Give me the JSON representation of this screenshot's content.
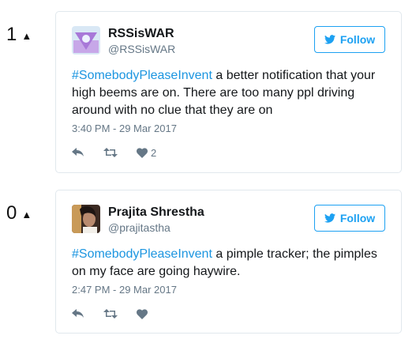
{
  "tweets": [
    {
      "vote_count": "1",
      "name": "RSSisWAR",
      "handle": "@RSSisWAR",
      "follow_label": "Follow",
      "hashtag": "#SomebodyPleaseInvent",
      "body": " a better notification that your high beems are on. There are too many ppl driving around with no clue that they are on",
      "timestamp": "3:40 PM - 29 Mar 2017",
      "like_count": "2"
    },
    {
      "vote_count": "0",
      "name": "Prajita Shrestha",
      "handle": "@prajitastha",
      "follow_label": "Follow",
      "hashtag": "#SomebodyPleaseInvent",
      "body": " a pimple tracker; the pimples on my face are going haywire.",
      "timestamp": "2:47 PM - 29 Mar 2017",
      "like_count": ""
    }
  ],
  "colors": {
    "accent": "#1da1f2",
    "link": "#1b95e0",
    "muted": "#657786",
    "border": "#e1e8ed"
  },
  "icons": [
    "upvote-arrow-icon",
    "twitter-bird-icon",
    "reply-icon",
    "retweet-icon",
    "heart-icon"
  ]
}
